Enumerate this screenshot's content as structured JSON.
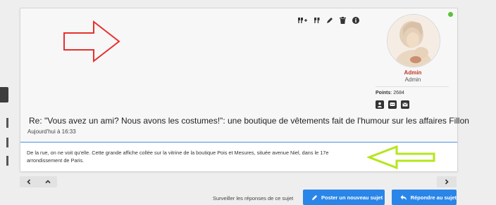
{
  "post": {
    "title": "Re: \"Vous avez un ami? Nous avons les costumes!\": une boutique de vêtements fait de l'humour sur les affaires Fillon",
    "date": "Aujourd'hui à 16:33",
    "body": "De la rue, on ne voit qu'elle. Cette grande affiche collée sur la vitrine de la boutique Pois et Mesures, située avenue Niel, dans le 17e arrondissement de Paris."
  },
  "author": {
    "username": "Admin",
    "rank": "Admin",
    "points_label": "Points",
    "points_value": ": 2684",
    "online": true,
    "username_color": "#c0392b"
  },
  "actions": [
    "multi-quote-icon",
    "quote-icon",
    "edit-icon",
    "delete-icon",
    "info-icon"
  ],
  "contact": [
    "profile-icon",
    "message-icon",
    "email-icon"
  ],
  "footer": {
    "watch_label": "Surveiller les réponses de ce sujet",
    "new_topic_label": "Poster un nouveau sujet",
    "reply_label": "Répondre au sujet"
  },
  "colors": {
    "accent": "#2a85e8",
    "annotation_red": "#e8302e",
    "annotation_green": "#b5e61d",
    "online": "#5cc13a"
  }
}
